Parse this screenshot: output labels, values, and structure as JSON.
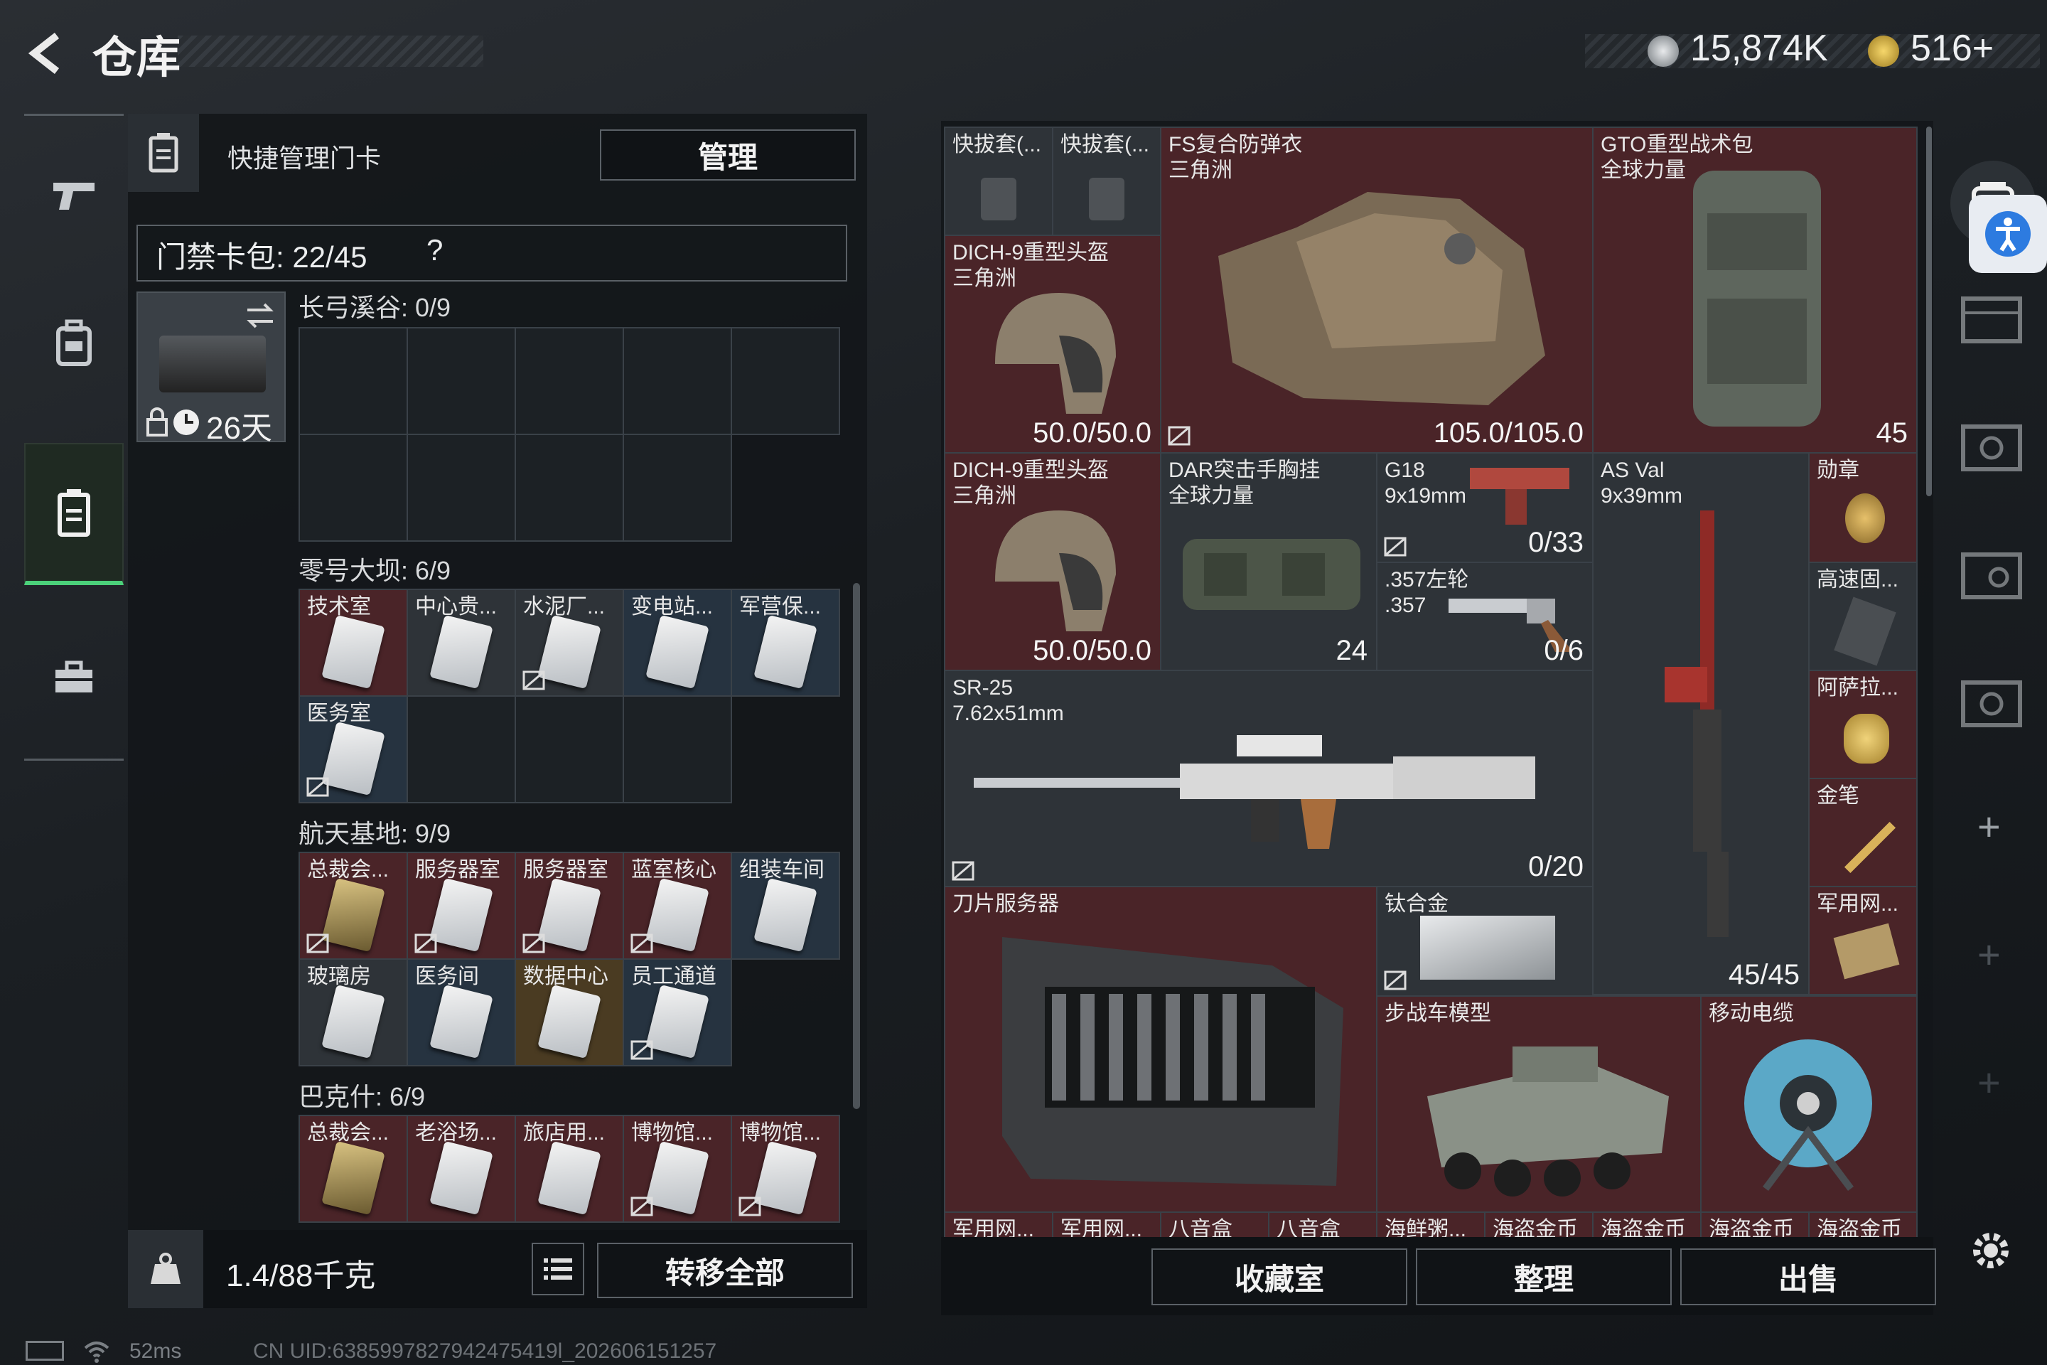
{
  "header": {
    "title": "仓库",
    "currency_1": "15,874K",
    "currency_2": "516+"
  },
  "left_panel": {
    "quick_card": "快捷管理门卡",
    "manage": "管理",
    "card_bag": "门禁卡包: 22/45",
    "help": "?",
    "days": "26天",
    "sections": [
      {
        "title": "长弓溪谷: 0/9"
      },
      {
        "title": "零号大坝: 6/9",
        "items": [
          "技术室",
          "中心贵...",
          "水泥厂...",
          "变电站...",
          "军营保...",
          "医务室"
        ]
      },
      {
        "title": "航天基地: 9/9",
        "items": [
          "总裁会...",
          "服务器室",
          "服务器室",
          "蓝室核心",
          "组装车间",
          "玻璃房",
          "医务间",
          "数据中心",
          "员工通道"
        ]
      },
      {
        "title": "巴克什: 6/9",
        "items": [
          "总裁会...",
          "老浴场...",
          "旅店用...",
          "博物馆...",
          "博物馆..."
        ]
      }
    ],
    "weight": "1.4/88千克",
    "transfer_all": "转移全部"
  },
  "inventory": {
    "holster1": "快拔套(...",
    "holster2": "快拔套(...",
    "armor": {
      "name": "FS复合防弹衣",
      "sub": "三角洲",
      "durability": "105.0/105.0"
    },
    "backpack": {
      "name": "GTO重型战术包",
      "sub": "全球力量",
      "count": "45"
    },
    "helmet1": {
      "name": "DICH-9重型头盔",
      "sub": "三角洲",
      "durability": "50.0/50.0"
    },
    "helmet2": {
      "name": "DICH-9重型头盔",
      "sub": "三角洲",
      "durability": "50.0/50.0"
    },
    "chest": {
      "name": "DAR突击手胸挂",
      "sub": "全球力量",
      "count": "24"
    },
    "g18": {
      "name": "G18",
      "sub": "9x19mm",
      "ammo": "0/33"
    },
    "revolver": {
      "name": ".357左轮",
      "sub": ".357",
      "ammo": "0/6"
    },
    "asval": {
      "name": "AS Val",
      "sub": "9x39mm",
      "ammo": "45/45"
    },
    "sr25": {
      "name": "SR-25",
      "sub": "7.62x51mm",
      "ammo": "0/20"
    },
    "medal": "勋章",
    "hdd": "高速固...",
    "teapot": "阿萨拉...",
    "pen": "金笔",
    "router": "军用网...",
    "blade": "刀片服务器",
    "titanium": "钛合金",
    "ifv": "步战车模型",
    "cable": "移动电缆",
    "bottom_row": [
      "军用网...",
      "军用网...",
      "八音盒",
      "八音盒",
      "海鲜粥...",
      "海盗金币",
      "海盗金币",
      "海盗金币",
      "海盗金币"
    ]
  },
  "buttons": {
    "collection": "收藏室",
    "sort": "整理",
    "sell": "出售"
  },
  "status": {
    "ping": "52ms",
    "uid": "CN UID:6385997827942475419l_202606151257"
  }
}
